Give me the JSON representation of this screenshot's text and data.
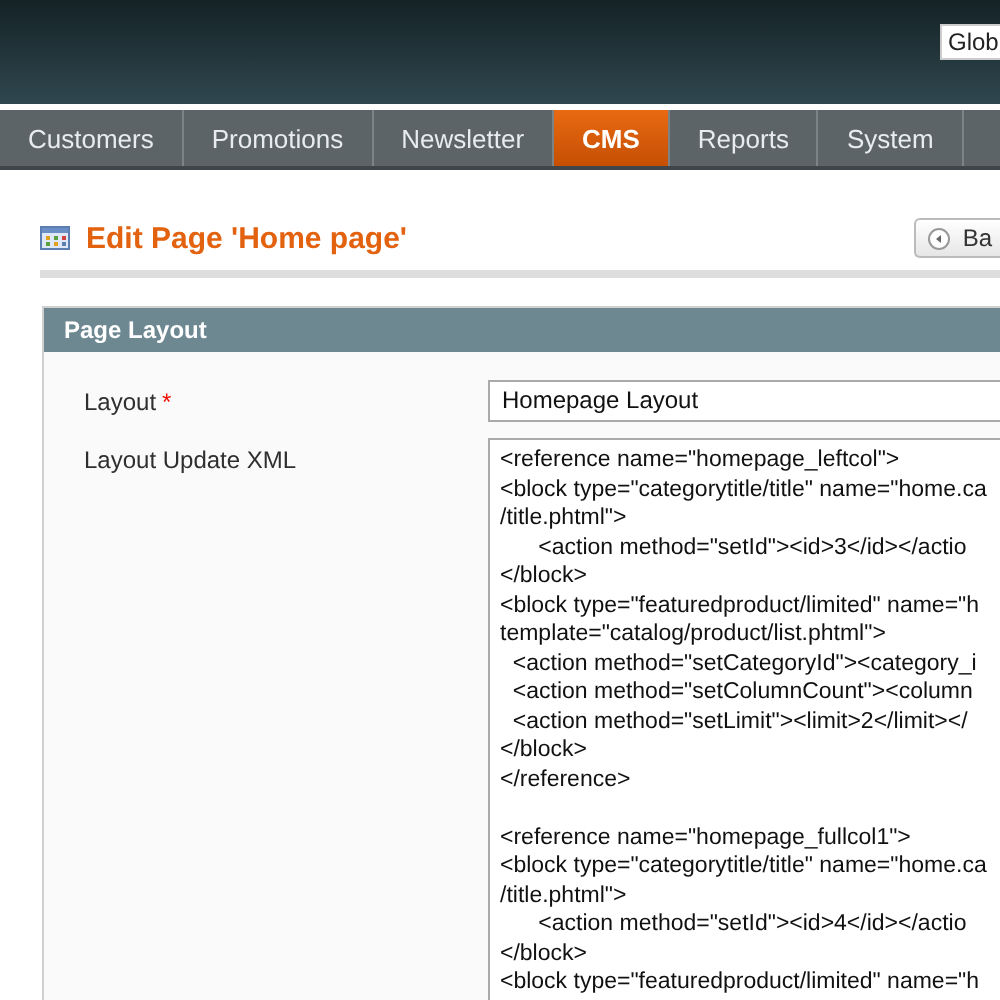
{
  "header": {
    "scope_field": {
      "value": "Glob"
    }
  },
  "nav": [
    {
      "label": "Customers",
      "selected": false
    },
    {
      "label": "Promotions",
      "selected": false
    },
    {
      "label": "Newsletter",
      "selected": false
    },
    {
      "label": "CMS",
      "selected": true
    },
    {
      "label": "Reports",
      "selected": false
    },
    {
      "label": "System",
      "selected": false
    }
  ],
  "page": {
    "title": "Edit Page 'Home page'",
    "back_button": "Ba"
  },
  "section": {
    "title": "Page Layout",
    "fields": [
      {
        "label": "Layout",
        "required_mark": "*",
        "kind": "select",
        "value": "Homepage Layout"
      },
      {
        "label": "Layout Update XML",
        "kind": "textarea",
        "blocks": [
          [
            "<reference name=\"homepage_leftcol\">",
            "<block type=\"categorytitle/title\" name=\"home.ca",
            "/title.phtml\">",
            "      <action method=\"setId\"><id>3</id></actio",
            "</block>",
            "<block type=\"featuredproduct/limited\" name=\"h",
            "template=\"catalog/product/list.phtml\">",
            "  <action method=\"setCategoryId\"><category_i",
            "  <action method=\"setColumnCount\"><column",
            "  <action method=\"setLimit\"><limit>2</limit></",
            "</block>",
            "</reference>"
          ],
          [
            "<reference name=\"homepage_fullcol1\">",
            "<block type=\"categorytitle/title\" name=\"home.ca",
            "/title.phtml\">",
            "      <action method=\"setId\"><id>4</id></actio",
            "</block>",
            "<block type=\"featuredproduct/limited\" name=\"h"
          ]
        ]
      }
    ]
  }
}
